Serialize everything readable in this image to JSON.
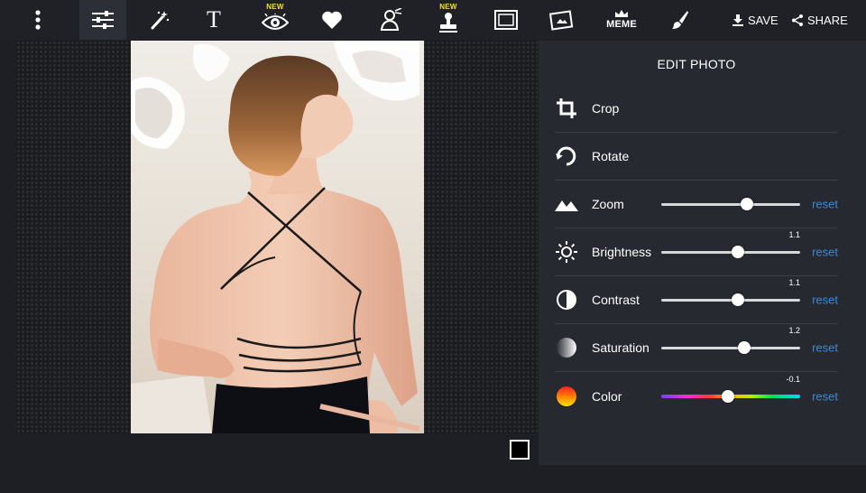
{
  "toolbar": {
    "tools": [
      {
        "name": "more-menu",
        "icon": "vertical-dots-icon"
      },
      {
        "name": "adjust",
        "icon": "sliders-icon",
        "active": true
      },
      {
        "name": "effects",
        "icon": "magic-wand-icon"
      },
      {
        "name": "text",
        "icon": "text-icon",
        "glyph": "T"
      },
      {
        "name": "overlays",
        "icon": "eye-icon",
        "badge": "NEW"
      },
      {
        "name": "stickers",
        "icon": "heart-icon"
      },
      {
        "name": "cutout",
        "icon": "person-cutout-icon"
      },
      {
        "name": "stamp",
        "icon": "stamp-icon",
        "badge": "NEW"
      },
      {
        "name": "frames",
        "icon": "frame-icon"
      },
      {
        "name": "photo-insert",
        "icon": "photo-icon"
      },
      {
        "name": "meme",
        "icon": "crown-icon",
        "label": "MEME"
      },
      {
        "name": "brush",
        "icon": "brush-icon"
      }
    ],
    "save_label": "SAVE",
    "share_label": "SHARE"
  },
  "panel": {
    "title": "EDIT PHOTO",
    "rows": [
      {
        "label": "Crop",
        "icon": "crop-icon"
      },
      {
        "label": "Rotate",
        "icon": "rotate-icon"
      },
      {
        "label": "Zoom",
        "icon": "mountains-icon",
        "slider_fraction": 0.62,
        "reset": "reset"
      },
      {
        "label": "Brightness",
        "icon": "sun-icon",
        "value": "1.1",
        "slider_fraction": 0.55,
        "reset": "reset"
      },
      {
        "label": "Contrast",
        "icon": "contrast-icon",
        "value": "1.1",
        "slider_fraction": 0.55,
        "reset": "reset"
      },
      {
        "label": "Saturation",
        "icon": "saturation-icon",
        "value": "1.2",
        "slider_fraction": 0.6,
        "reset": "reset"
      },
      {
        "label": "Color",
        "icon": "color-icon",
        "value": "-0.1",
        "slider_fraction": 0.48,
        "reset": "reset",
        "rainbow": true
      }
    ]
  },
  "colors": {
    "accent": "#3b8ad8",
    "badge": "#f2e230",
    "panel_bg": "#262930",
    "toolbar_bg": "#1f2126"
  }
}
